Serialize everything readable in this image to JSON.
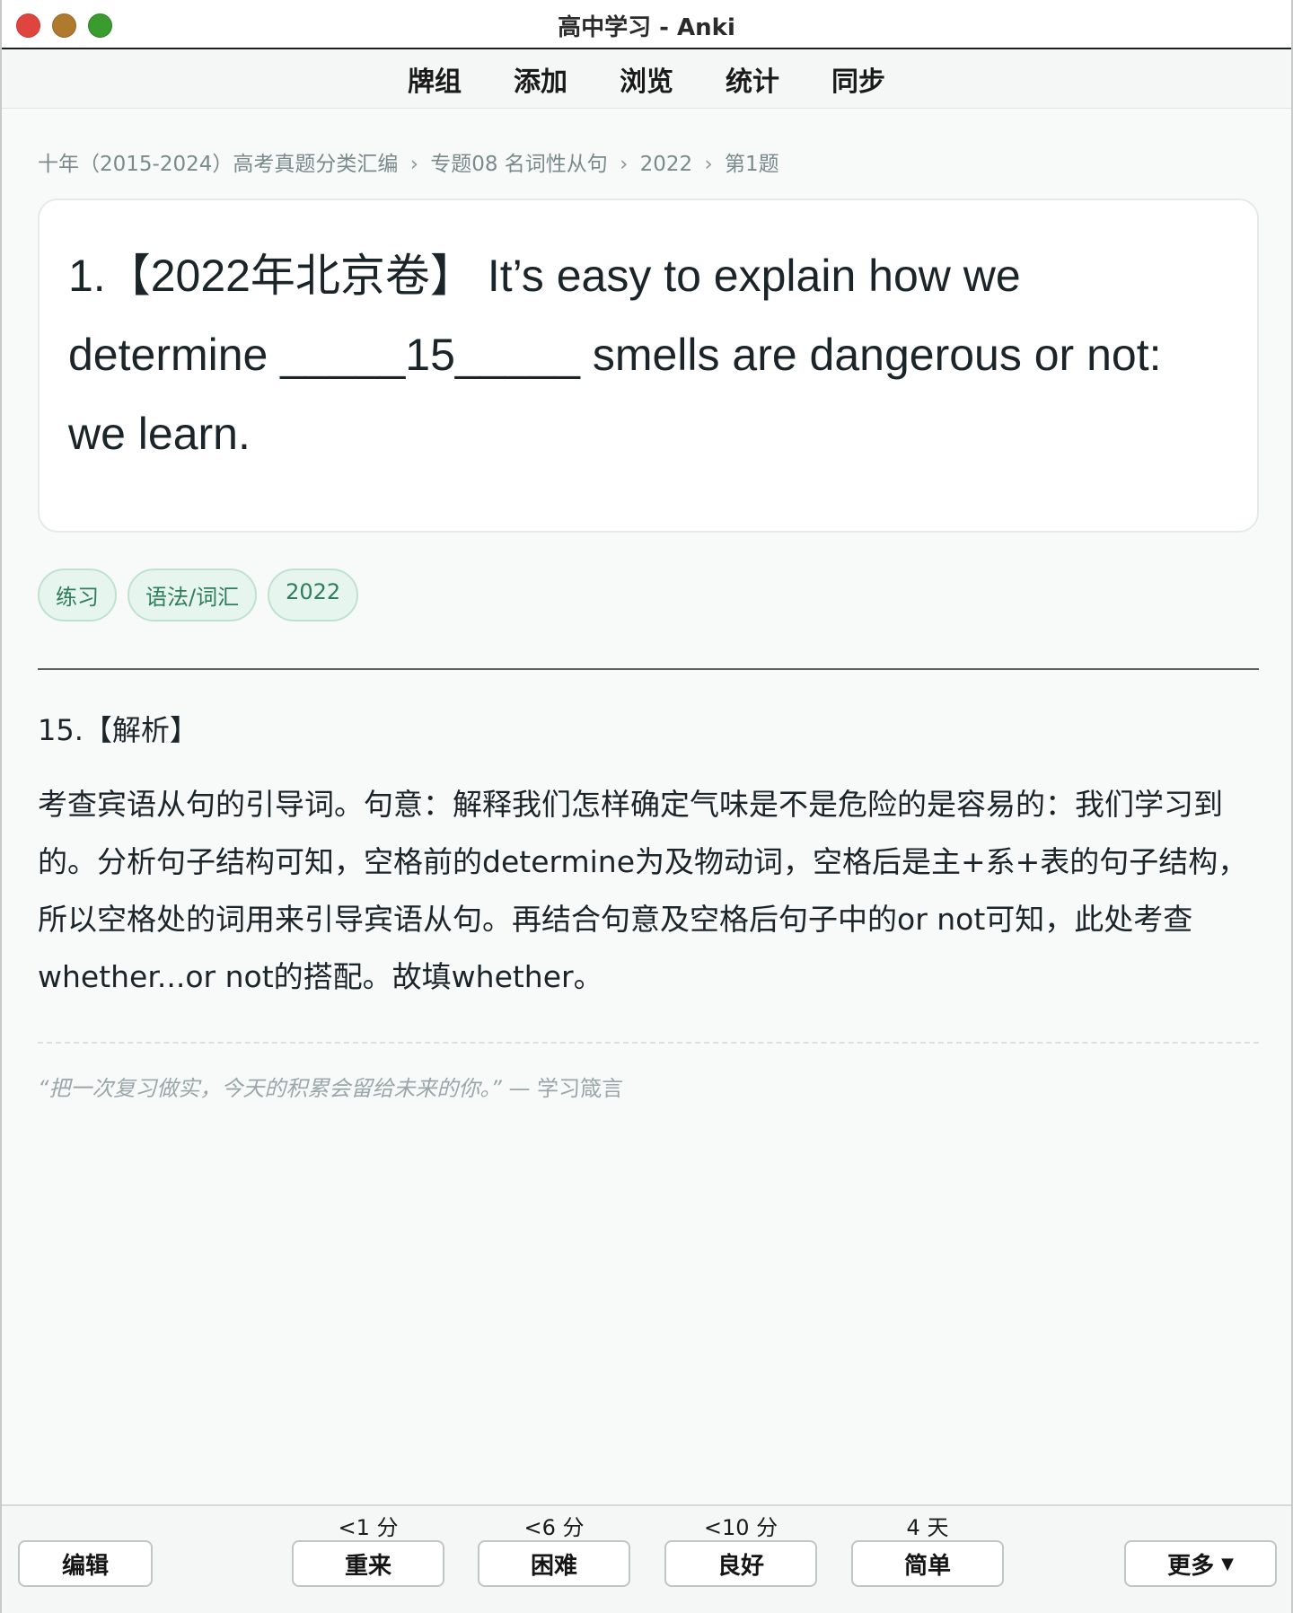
{
  "window": {
    "title": "高中学习 - Anki"
  },
  "toolbar": {
    "items": [
      "牌组",
      "添加",
      "浏览",
      "统计",
      "同步"
    ]
  },
  "breadcrumb": {
    "parts": [
      "十年（2015-2024）高考真题分类汇编",
      "专题08 名词性从句",
      "2022",
      "第1题"
    ],
    "separator": "›"
  },
  "card": {
    "question": "1.【2022年北京卷】 It’s easy to explain how we determine _____15_____ smells are dangerous or not: we learn."
  },
  "tags": [
    "练习",
    "语法/词汇",
    "2022"
  ],
  "answer": {
    "heading": "15.【解析】",
    "body": "考查宾语从句的引导词。句意：解释我们怎样确定气味是不是危险的是容易的：我们学习到的。分析句子结构可知，空格前的determine为及物动词，空格后是主+系+表的句子结构，所以空格处的词用来引导宾语从句。再结合句意及空格后句子中的or not可知，此处考查whether...or not的搭配。故填whether。"
  },
  "quote": {
    "text": "“把一次复习做实，今天的积累会留给未来的你。”",
    "source": "— 学习箴言"
  },
  "bottom": {
    "edit_label": "编辑",
    "more_label": "更多",
    "answers": [
      {
        "label": "重来",
        "interval": "<1 分"
      },
      {
        "label": "困难",
        "interval": "<6 分"
      },
      {
        "label": "良好",
        "interval": "<10 分"
      },
      {
        "label": "简单",
        "interval": "4 天"
      }
    ]
  }
}
